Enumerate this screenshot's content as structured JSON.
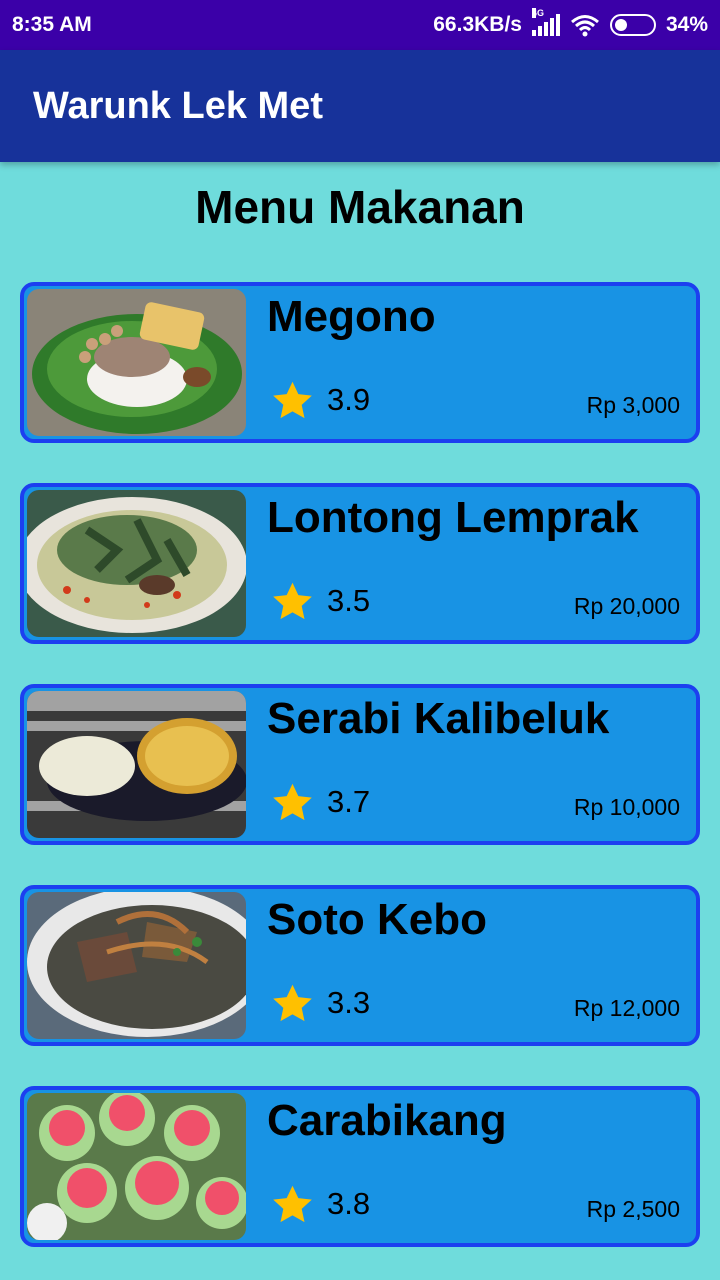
{
  "status_bar": {
    "time": "8:35 AM",
    "speed": "66.3KB/s",
    "network": "4G",
    "battery": "34%",
    "battery_level": 0.34
  },
  "app_bar": {
    "title": "Warunk Lek Met"
  },
  "heading": "Menu Makanan",
  "menu": [
    {
      "name": "Megono",
      "rating": "3.9",
      "price": "Rp 3,000",
      "image_icon": "megono-photo"
    },
    {
      "name": "Lontong Lemprak",
      "rating": "3.5",
      "price": "Rp 20,000",
      "image_icon": "lontong-lemprak-photo"
    },
    {
      "name": "Serabi Kalibeluk",
      "rating": "3.7",
      "price": "Rp 10,000",
      "image_icon": "serabi-kalibeluk-photo"
    },
    {
      "name": "Soto Kebo",
      "rating": "3.3",
      "price": "Rp 12,000",
      "image_icon": "soto-kebo-photo"
    },
    {
      "name": "Carabikang",
      "rating": "3.8",
      "price": "Rp 2,500",
      "image_icon": "carabikang-photo"
    }
  ],
  "colors": {
    "status_bar": "#3b00a8",
    "app_bar": "#17329a",
    "background": "#6fdcdc",
    "card": "#1893e4",
    "card_border": "#1c3ff0",
    "star": "#ffc000"
  }
}
